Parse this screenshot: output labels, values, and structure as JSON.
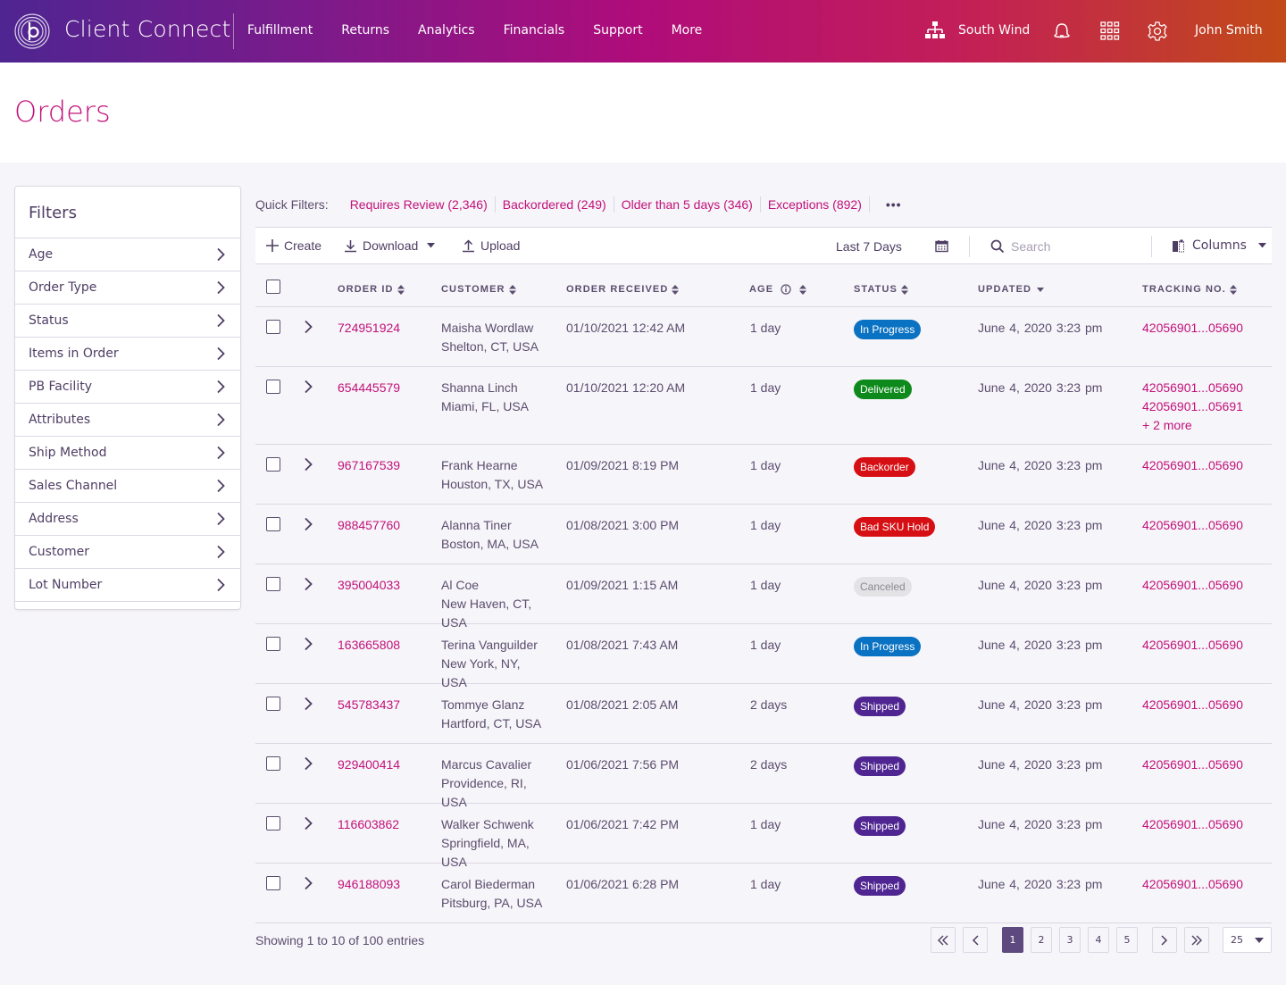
{
  "header": {
    "brand": "Client Connect",
    "nav": [
      "Fulfillment",
      "Returns",
      "Analytics",
      "Financials",
      "Support",
      "More"
    ],
    "org_name": "South Wind",
    "user_name": "John Smith",
    "gradient": [
      "#4e2591",
      "#b00c7a",
      "#c24a18"
    ]
  },
  "page": {
    "title": "Orders"
  },
  "filters": {
    "title": "Filters",
    "items": [
      "Age",
      "Order Type",
      "Status",
      "Items in Order",
      "PB Facility",
      "Attributes",
      "Ship Method",
      "Sales Channel",
      "Address",
      "Customer",
      "Lot Number"
    ]
  },
  "quick_filters": {
    "label": "Quick Filters:",
    "items": [
      "Requires Review (2,346)",
      "Backordered (249)",
      "Older than 5 days (346)",
      "Exceptions (892)"
    ],
    "more": "•••"
  },
  "toolbar": {
    "create": "Create",
    "download": "Download",
    "upload": "Upload",
    "date_range": "Last 7 Days",
    "search_placeholder": "Search",
    "columns": "Columns"
  },
  "table": {
    "columns": [
      "ORDER ID",
      "CUSTOMER",
      "ORDER RECEIVED",
      "AGE",
      "STATUS",
      "UPDATED",
      "TRACKING NO."
    ],
    "rows": [
      {
        "id": "724951924",
        "name": "Maisha Wordlaw",
        "loc": "Shelton, CT, USA",
        "received": "01/10/2021 12:42 AM",
        "age": "1 day",
        "status": "In Progress",
        "updated": "June 4, 2020  3:23 pm",
        "tracking": [
          "42056901...05690"
        ]
      },
      {
        "id": "654445579",
        "name": "Shanna Linch",
        "loc": "Miami, FL, USA",
        "received": "01/10/2021 12:20 AM",
        "age": "1 day",
        "status": "Delivered",
        "updated": "June 4, 2020  3:23 pm",
        "tracking": [
          "42056901...05690",
          "42056901...05691"
        ],
        "tracking_more": "+ 2 more"
      },
      {
        "id": "967167539",
        "name": "Frank Hearne",
        "loc": "Houston, TX, USA",
        "received": "01/09/2021 8:19 PM",
        "age": "1 day",
        "status": "Backorder",
        "updated": "June 4, 2020  3:23 pm",
        "tracking": [
          "42056901...05690"
        ]
      },
      {
        "id": "988457760",
        "name": "Alanna Tiner",
        "loc": "Boston, MA, USA",
        "received": "01/08/2021 3:00 PM",
        "age": "1 day",
        "status": "Bad SKU Hold",
        "updated": "June 4, 2020  3:23 pm",
        "tracking": [
          "42056901...05690"
        ]
      },
      {
        "id": "395004033",
        "name": "Al Coe",
        "loc": "New Haven, CT, USA",
        "received": "01/09/2021 1:15 AM",
        "age": "1 day",
        "status": "Canceled",
        "updated": "June 4, 2020  3:23 pm",
        "tracking": [
          "42056901...05690"
        ]
      },
      {
        "id": "163665808",
        "name": "Terina Vanguilder",
        "loc": "New York, NY, USA",
        "received": "01/08/2021 7:43 AM",
        "age": "1 day",
        "status": "In Progress",
        "updated": "June 4, 2020  3:23 pm",
        "tracking": [
          "42056901...05690"
        ]
      },
      {
        "id": "545783437",
        "name": "Tommye Glanz",
        "loc": "Hartford, CT, USA",
        "received": "01/08/2021 2:05 AM",
        "age": "2 days",
        "status": "Shipped",
        "updated": "June 4, 2020  3:23 pm",
        "tracking": [
          "42056901...05690"
        ]
      },
      {
        "id": "929400414",
        "name": "Marcus Cavalier",
        "loc": "Providence, RI, USA",
        "received": "01/06/2021 7:56 PM",
        "age": "2 days",
        "status": "Shipped",
        "updated": "June 4, 2020  3:23 pm",
        "tracking": [
          "42056901...05690"
        ]
      },
      {
        "id": "116603862",
        "name": "Walker Schwenk",
        "loc": "Springfield, MA, USA",
        "received": "01/06/2021 7:42 PM",
        "age": "1 day",
        "status": "Shipped",
        "updated": "June 4, 2020  3:23 pm",
        "tracking": [
          "42056901...05690"
        ]
      },
      {
        "id": "946188093",
        "name": "Carol Biederman",
        "loc": "Pitsburg, PA, USA",
        "received": "01/06/2021 6:28 PM",
        "age": "1 day",
        "status": "Shipped",
        "updated": "June 4, 2020  3:23 pm",
        "tracking": [
          "42056901...05690"
        ]
      }
    ]
  },
  "status_colors": {
    "In Progress": {
      "bg": "#0a72c2",
      "fg": "#ffffff"
    },
    "Delivered": {
      "bg": "#0d8a1b",
      "fg": "#ffffff"
    },
    "Backorder": {
      "bg": "#d50f14",
      "fg": "#ffffff"
    },
    "Bad SKU Hold": {
      "bg": "#d50f14",
      "fg": "#ffffff"
    },
    "Canceled": {
      "bg": "#e3e3e6",
      "fg": "#8a8890"
    },
    "Shipped": {
      "bg": "#4e2591",
      "fg": "#ffffff"
    }
  },
  "footer": {
    "showing": "Showing 1 to 10 of 100 entries",
    "pages": [
      "1",
      "2",
      "3",
      "4",
      "5"
    ],
    "current_page": "1",
    "page_size": "25"
  },
  "colors": {
    "accent": "#c2117a",
    "text": "#4e3d63",
    "active_page": "#5e4a7e"
  }
}
